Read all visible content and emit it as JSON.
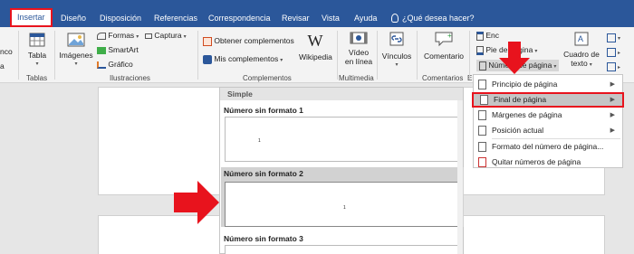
{
  "tabs": [
    "Insertar",
    "Diseño",
    "Disposición",
    "Referencias",
    "Correspondencia",
    "Revisar",
    "Vista",
    "Ayuda"
  ],
  "tell_me": "¿Qué desea hacer?",
  "ribbon": {
    "left_partial": [
      "nco",
      "a"
    ],
    "tabla": "Tabla",
    "tablas_group": "Tablas",
    "imagenes": "Imágenes",
    "formas": "Formas",
    "smartart": "SmartArt",
    "grafico": "Gráfico",
    "captura": "Captura",
    "ilustraciones_group": "Ilustraciones",
    "obtener_complementos": "Obtener complementos",
    "mis_complementos": "Mis complementos",
    "wikipedia": "Wikipedia",
    "complementos_group": "Complementos",
    "video_line1": "Vídeo",
    "video_line2": "en línea",
    "multimedia_group": "Multimedia",
    "vinculos": "Vínculos",
    "comentario": "Comentario",
    "comentarios_group": "Comentarios",
    "group_cut": "E",
    "encabezado_partial": "Enc",
    "pie_de_pagina": "Pie de página",
    "numero_de_pagina": "Número de página",
    "cuadro_line1": "Cuadro de",
    "cuadro_line2": "texto"
  },
  "gallery": {
    "header": "Simple",
    "items": [
      "Número sin formato 1",
      "Número sin formato 2",
      "Número sin formato 3"
    ],
    "thumb_number": "1"
  },
  "menu": {
    "items": [
      {
        "label": "Principio de página",
        "submenu": true
      },
      {
        "label": "Final de página",
        "submenu": true,
        "highlighted": true
      },
      {
        "label": "Márgenes de página",
        "submenu": true
      },
      {
        "label": "Posición actual",
        "submenu": true
      },
      {
        "label": "Formato del número de página...",
        "submenu": false
      },
      {
        "label": "Quitar números de página",
        "submenu": false
      }
    ]
  },
  "colors": {
    "accent": "#2b579a",
    "callout": "#e8131d",
    "highlight": "#c5c5c5"
  }
}
